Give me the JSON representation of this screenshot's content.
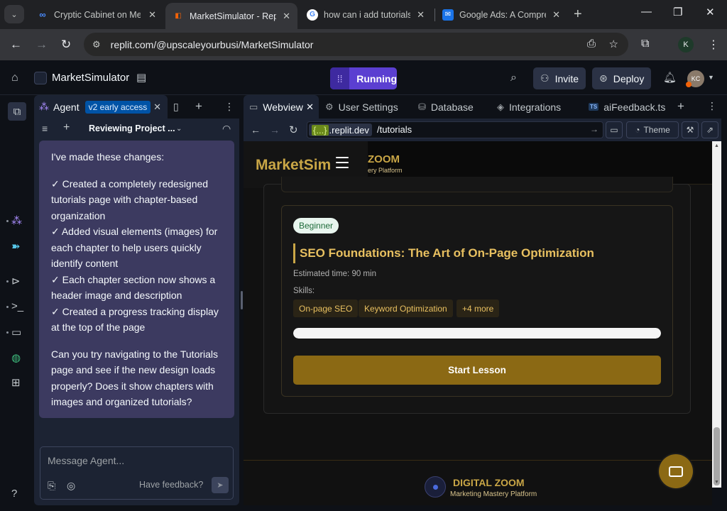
{
  "browser": {
    "tabs": [
      {
        "title": "Cryptic Cabinet on Meta",
        "icon": "meta-icon"
      },
      {
        "title": "MarketSimulator - Replit",
        "icon": "replit-icon",
        "active": true
      },
      {
        "title": "how can i add tutorials",
        "icon": "google-icon"
      },
      {
        "title": "Google Ads: A Comprehensive",
        "icon": "mail-icon"
      }
    ],
    "url": "replit.com/@upscaleyourbusi/MarketSimulator",
    "profile_initial": "K"
  },
  "replit": {
    "project_name": "MarketSimulator",
    "run_status": "Running",
    "invite_label": "Invite",
    "deploy_label": "Deploy",
    "avatar_initials": "KC"
  },
  "agent": {
    "tab_label": "Agent",
    "badge": "v2 early access",
    "thread_title": "Reviewing Project ...",
    "message": {
      "intro": "I've made these changes:",
      "items": [
        "✓ Created a completely redesigned tutorials page with chapter-based organization",
        "✓ Added visual elements (images) for each chapter to help users quickly identify content",
        "✓ Each chapter section now shows a header image and description",
        "✓ Created a progress tracking display at the top of the page"
      ],
      "question": "Can you try navigating to the Tutorials page and see if the new design loads properly? Does it show chapters with images and organized tutorials?"
    },
    "input_placeholder": "Message Agent...",
    "feedback_label": "Have feedback?"
  },
  "pane_tabs": [
    {
      "label": "Webview",
      "icon": "monitor-icon",
      "active": true
    },
    {
      "label": "User Settings",
      "icon": "gear-icon"
    },
    {
      "label": "Database",
      "icon": "database-icon"
    },
    {
      "label": "Integrations",
      "icon": "layers-icon"
    },
    {
      "label": "aiFeedback.ts",
      "icon": "ts-file-icon"
    }
  ],
  "webview": {
    "domain_prefix": "{...}",
    "domain": ".replit.dev",
    "path": "/tutorials",
    "theme_label": "Theme"
  },
  "site": {
    "brand": "MarketSim",
    "logo_title": "ZOOM",
    "logo_subtitle": "ery Platform",
    "lesson": {
      "level": "Beginner",
      "title": "SEO Foundations: The Art of On-Page Optimization",
      "time": "Estimated time: 90 min",
      "skills_label": "Skills:",
      "skills": [
        "On-page SEO",
        "Keyword Optimization",
        "+4 more"
      ],
      "progress": 1.0,
      "cta": "Start Lesson"
    },
    "footer_title": "DIGITAL ZOOM",
    "footer_subtitle": "Marketing Mastery Platform"
  }
}
